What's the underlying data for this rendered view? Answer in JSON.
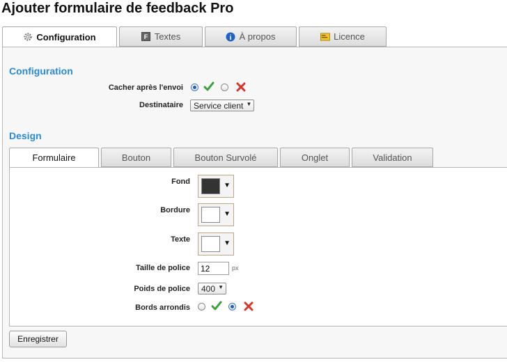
{
  "page": {
    "title": "Ajouter formulaire de feedback Pro"
  },
  "tabs": [
    {
      "label": "Configuration",
      "icon": "gear-icon",
      "active": true
    },
    {
      "label": "Textes",
      "icon": "text-box-icon",
      "active": false
    },
    {
      "label": "À propos",
      "icon": "info-icon",
      "active": false
    },
    {
      "label": "Licence",
      "icon": "license-card-icon",
      "active": false
    }
  ],
  "configuration": {
    "heading": "Configuration",
    "hide_after_send": {
      "label": "Cacher après l'envoi",
      "value": "yes"
    },
    "recipient": {
      "label": "Destinataire",
      "value": "Service client"
    }
  },
  "design": {
    "heading": "Design",
    "subtabs": [
      {
        "label": "Formulaire",
        "active": true
      },
      {
        "label": "Bouton",
        "active": false
      },
      {
        "label": "Bouton Survolé",
        "active": false
      },
      {
        "label": "Onglet",
        "active": false
      },
      {
        "label": "Validation",
        "active": false
      }
    ],
    "fields": {
      "background": {
        "label": "Fond",
        "color": "#333333"
      },
      "border": {
        "label": "Bordure",
        "color": "#ffffff"
      },
      "text": {
        "label": "Texte",
        "color": "#ffffff"
      },
      "font_size": {
        "label": "Taille de police",
        "value": "12",
        "unit": "px"
      },
      "font_weight": {
        "label": "Poids de police",
        "value": "400"
      },
      "rounded_corners": {
        "label": "Bords arrondis",
        "value": "no"
      }
    }
  },
  "actions": {
    "save_label": "Enregistrer"
  },
  "colors": {
    "accent": "#2a8ad6",
    "check": "#3aa13a",
    "cross": "#d9342b",
    "radio_selected": "#1d5fb8"
  }
}
